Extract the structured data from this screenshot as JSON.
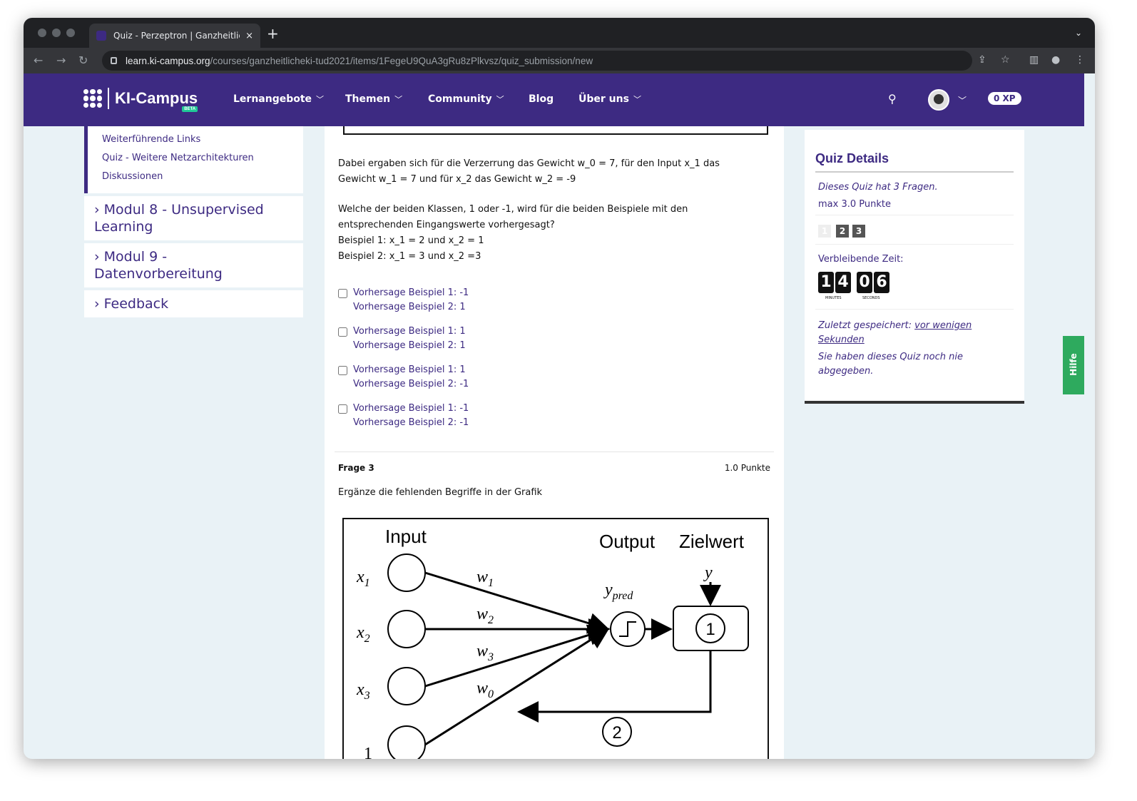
{
  "browser": {
    "tab_title": "Quiz - Perzeptron | Ganzheitlic",
    "tab_close": "×",
    "new_tab": "+",
    "url_host": "learn.ki-campus.org",
    "url_path": "/courses/ganzheitlicheki-tud2021/items/1FegeU9QuA3gRu8zPlkvsz/quiz_submission/new"
  },
  "header": {
    "logo_text": "KI-Campus",
    "logo_badge": "BETA",
    "menu": [
      {
        "label": "Lernangebote"
      },
      {
        "label": "Themen"
      },
      {
        "label": "Community"
      },
      {
        "label": "Blog"
      },
      {
        "label": "Über uns"
      }
    ],
    "xp_label": "0 XP"
  },
  "sidebar": {
    "links": [
      "Weiterführende Links",
      "Quiz - Weitere Netzarchitekturen",
      "Diskussionen"
    ],
    "modules": [
      {
        "label": "› Modul 8 - Unsupervised Learning"
      },
      {
        "label": "› Modul 9 - Datenvorbereitung"
      },
      {
        "label": "› Feedback"
      }
    ]
  },
  "question2": {
    "text_line1": "Dabei ergaben sich für die Verzerrung das Gewicht w_0 = 7, für den Input x_1 das",
    "text_line2": "Gewicht w_1 = 7 und für x_2 das Gewicht w_2 = -9",
    "text_line3": "Welche der beiden Klassen, 1 oder -1, wird für die beiden Beispiele mit den",
    "text_line4": "entsprechenden Eingangswerte vorhergesagt?",
    "text_line5": "Beispiel 1: x_1 = 2 und x_2 = 1",
    "text_line6": "Beispiel 2: x_1 = 3 und x_2 =3",
    "options": [
      {
        "line1": "Vorhersage Beispiel 1: -1",
        "line2": "Vorhersage Beispiel 2: 1"
      },
      {
        "line1": "Vorhersage Beispiel 1: 1",
        "line2": "Vorhersage Beispiel 2: 1"
      },
      {
        "line1": "Vorhersage Beispiel 1: 1",
        "line2": "Vorhersage Beispiel 2: -1"
      },
      {
        "line1": "Vorhersage Beispiel 1: -1",
        "line2": "Vorhersage Beispiel 2: -1"
      }
    ]
  },
  "question3": {
    "title": "Frage 3",
    "points": "1.0 Punkte",
    "text": "Ergänze die fehlenden Begriffe in der Grafik",
    "diagram": {
      "input": "Input",
      "output": "Output",
      "zielwert": "Zielwert",
      "x1": "x",
      "x1_sub": "1",
      "x2": "x",
      "x2_sub": "2",
      "x3": "x",
      "x3_sub": "3",
      "bias": "1",
      "w1": "w",
      "w1_sub": "1",
      "w2": "w",
      "w2_sub": "2",
      "w3": "w",
      "w3_sub": "3",
      "w0": "w",
      "w0_sub": "0",
      "ypred": "y",
      "ypred_sub": "pred",
      "y": "y",
      "box1": "1",
      "box2": "2"
    }
  },
  "quiz_details": {
    "title": "Quiz Details",
    "question_count": "Dieses Quiz hat 3 Fragen.",
    "max_points": "max 3.0 Punkte",
    "nav": [
      "1",
      "2",
      "3"
    ],
    "remaining_label": "Verbleibende Zeit:",
    "minutes": [
      "1",
      "4"
    ],
    "seconds": [
      "0",
      "6"
    ],
    "minutes_label": "MINUTES",
    "seconds_label": "SECONDS",
    "saved_prefix": "Zuletzt gespeichert:",
    "saved_link": "vor wenigen Sekunden",
    "never_submitted": "Sie haben dieses Quiz noch nie abgegeben."
  },
  "help_tab": "Hilfe"
}
